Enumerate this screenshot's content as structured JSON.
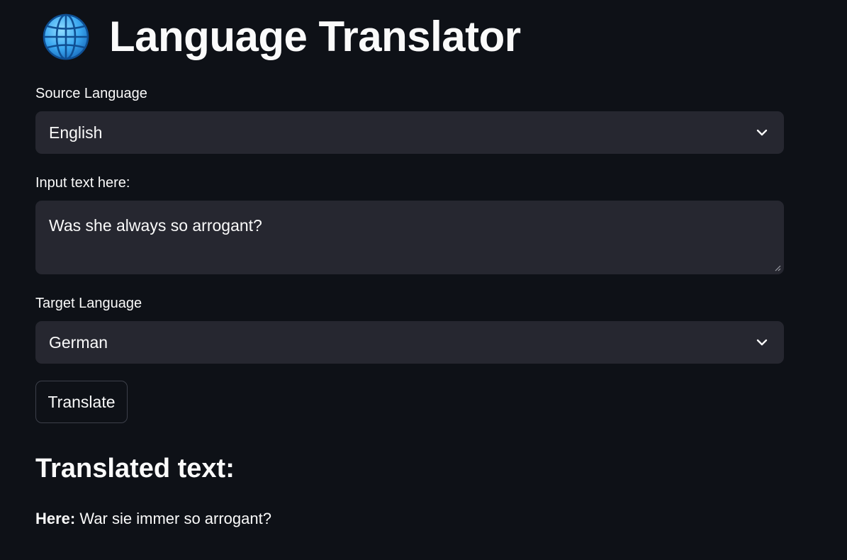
{
  "header": {
    "icon": "globe-icon",
    "title": "Language Translator"
  },
  "form": {
    "source_label": "Source Language",
    "source_value": "English",
    "input_label": "Input text here:",
    "input_value": "Was she always so arrogant?",
    "target_label": "Target Language",
    "target_value": "German",
    "translate_button": "Translate"
  },
  "output": {
    "heading": "Translated text:",
    "prefix": "Here:",
    "text": "War sie immer so arrogant?"
  },
  "colors": {
    "background": "#0e1117",
    "field": "#262730",
    "text": "#fafafa",
    "border": "#3d404a"
  }
}
